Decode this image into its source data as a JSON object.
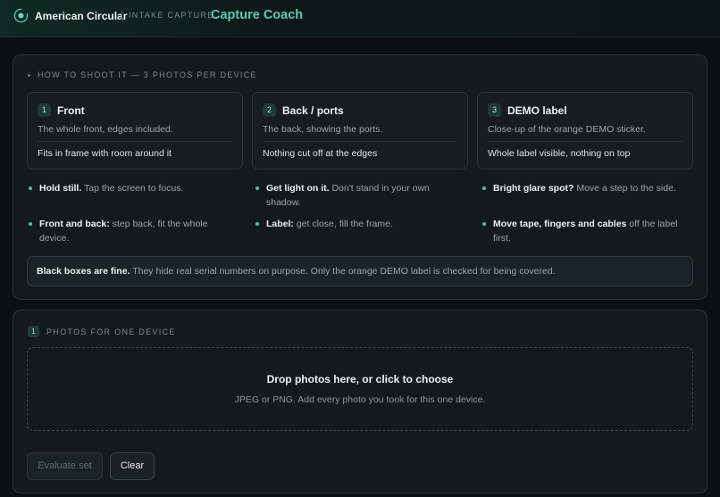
{
  "header": {
    "brand": "American Circular",
    "section": "INTAKE CAPTURE",
    "title": "Capture Coach",
    "accent_color": "#5ec6b8"
  },
  "guide": {
    "heading": "HOW TO SHOOT IT — 3 PHOTOS PER DEVICE",
    "steps": [
      {
        "num": "1",
        "title": "Front",
        "desc": "The whole front, edges included.",
        "check": "Fits in frame with room around it"
      },
      {
        "num": "2",
        "title": "Back / ports",
        "desc": "The back, showing the ports.",
        "check": "Nothing cut off at the edges"
      },
      {
        "num": "3",
        "title": "DEMO label",
        "desc": "Close-up of the orange DEMO sticker.",
        "check": "Whole label visible, nothing on top"
      }
    ],
    "tips": [
      {
        "bold": "Hold still.",
        "text": " Tap the screen to focus."
      },
      {
        "bold": "Get light on it.",
        "text": " Don't stand in your own shadow."
      },
      {
        "bold": "Bright glare spot?",
        "text": " Move a step to the side."
      },
      {
        "bold": "Front and back:",
        "text": " step back, fit the whole device."
      },
      {
        "bold": "Label:",
        "text": " get close, fill the frame."
      },
      {
        "bold": "Move tape, fingers and cables",
        "text": " off the label first."
      }
    ],
    "note": {
      "bold": "Black boxes are fine.",
      "text": " They hide real serial numbers on purpose. Only the orange DEMO label is checked for being covered."
    }
  },
  "upload": {
    "num": "1",
    "heading": "PHOTOS FOR ONE DEVICE",
    "drop_title": "Drop photos here, or click to choose",
    "drop_sub": "JPEG or PNG. Add every photo you took for this one device.",
    "evaluate_label": "Evaluate set",
    "clear_label": "Clear"
  }
}
